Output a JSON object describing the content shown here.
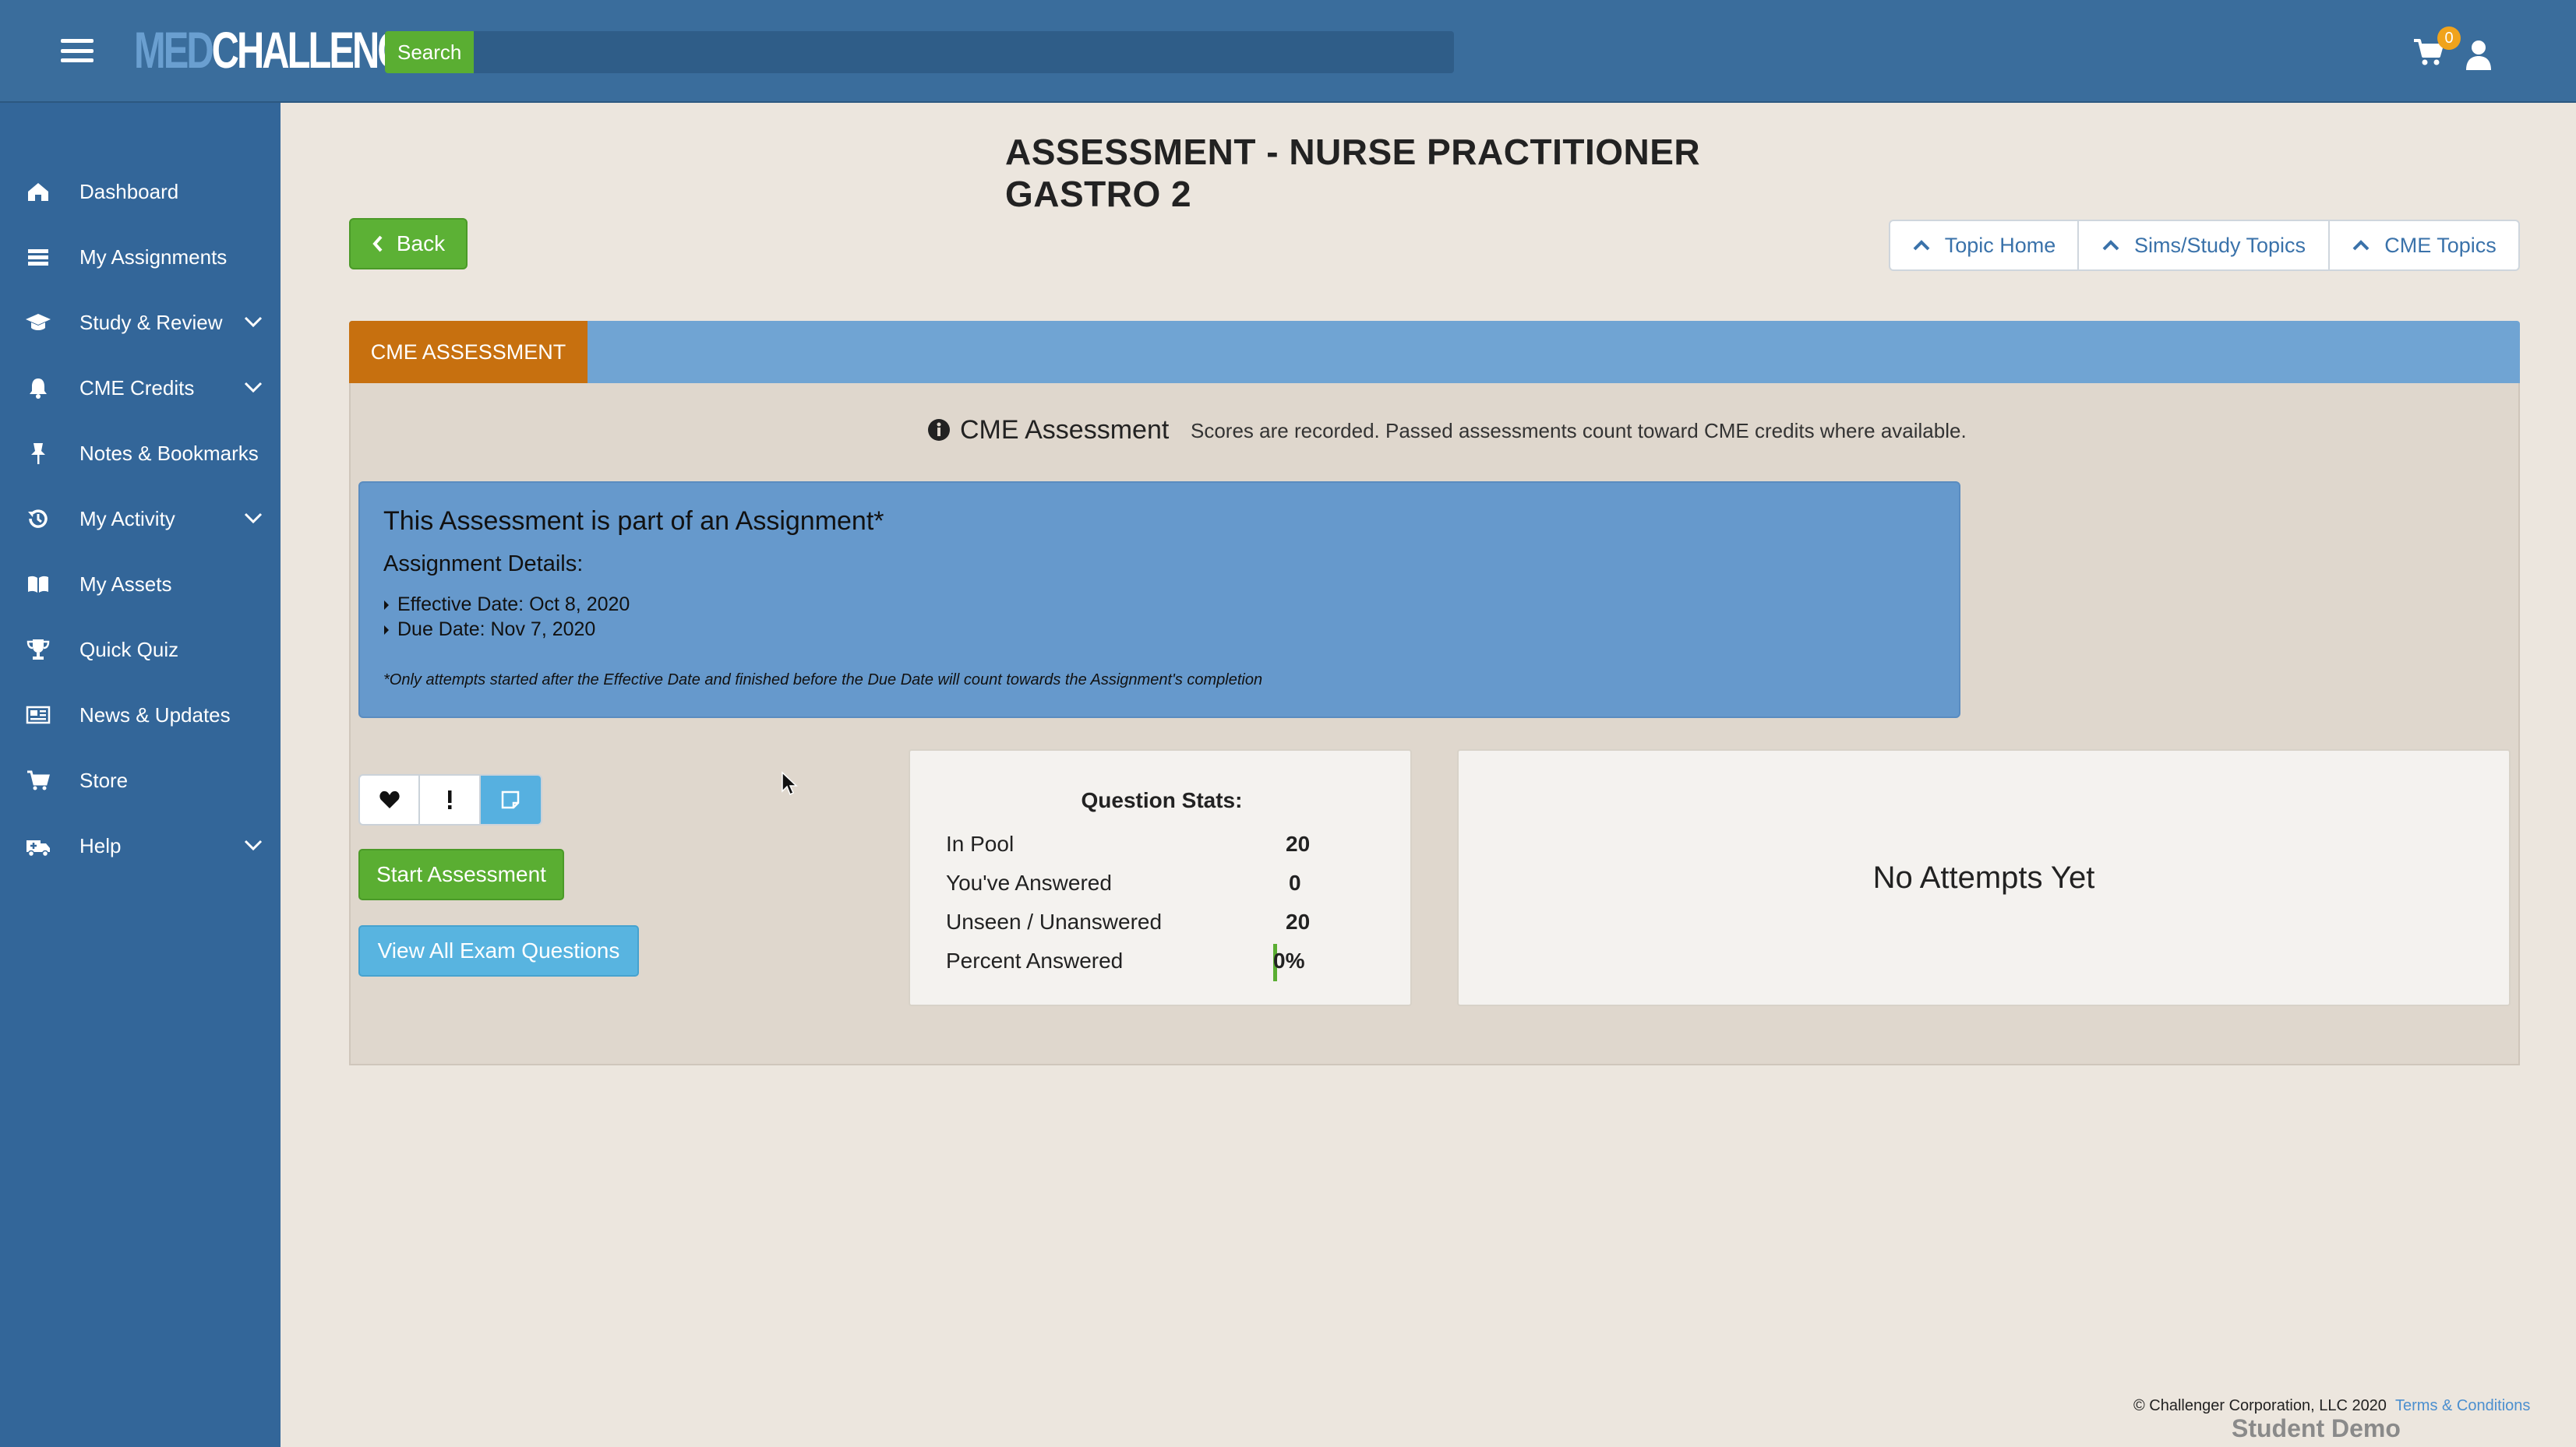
{
  "header": {
    "logo_med": "MED",
    "logo_challenger": "CHALLENGER",
    "search_label": "Search",
    "search_placeholder": "",
    "cart_count": "0"
  },
  "sidebar": {
    "items": [
      {
        "label": "Dashboard",
        "icon": "home-icon",
        "expandable": false
      },
      {
        "label": "My Assignments",
        "icon": "list-icon",
        "expandable": false
      },
      {
        "label": "Study & Review",
        "icon": "graduation-cap-icon",
        "expandable": true
      },
      {
        "label": "CME Credits",
        "icon": "bell-icon",
        "expandable": true
      },
      {
        "label": "Notes & Bookmarks",
        "icon": "pin-icon",
        "expandable": false
      },
      {
        "label": "My Activity",
        "icon": "history-icon",
        "expandable": true
      },
      {
        "label": "My Assets",
        "icon": "book-icon",
        "expandable": false
      },
      {
        "label": "Quick Quiz",
        "icon": "trophy-icon",
        "expandable": false
      },
      {
        "label": "News & Updates",
        "icon": "newspaper-icon",
        "expandable": false
      },
      {
        "label": "Store",
        "icon": "cart-icon",
        "expandable": false
      },
      {
        "label": "Help",
        "icon": "ambulance-icon",
        "expandable": true
      }
    ]
  },
  "main": {
    "title": "ASSESSMENT - NURSE PRACTITIONER GASTRO 2",
    "back_label": "Back",
    "topic_buttons": [
      "Topic Home",
      "Sims/Study Topics",
      "CME Topics"
    ],
    "tab_label": "CME ASSESSMENT",
    "cme_heading": "CME Assessment",
    "cme_note": "Scores are recorded. Passed assessments count toward CME credits where available.",
    "assignment": {
      "title": "This Assessment is part of an Assignment*",
      "details_label": "Assignment Details:",
      "effective": "Effective Date: Oct 8, 2020",
      "due": "Due Date: Nov 7, 2020",
      "footnote": "*Only attempts started after the Effective Date and finished before the Due Date will count towards the Assignment's completion"
    },
    "start_label": "Start Assessment",
    "view_label": "View All Exam Questions",
    "stats": {
      "title": "Question Stats:",
      "rows": [
        {
          "label": "In Pool",
          "value": "20"
        },
        {
          "label": "You've Answered",
          "value": "0"
        },
        {
          "label": "Unseen / Unanswered",
          "value": "20"
        },
        {
          "label": "Percent Answered",
          "value": "0%"
        }
      ],
      "percent_answered": 0
    },
    "attempts_text": "No Attempts Yet"
  },
  "footer": {
    "copyright": "© Challenger Corporation, LLC 2020",
    "terms": "Terms & Conditions",
    "student": "Student Demo (student_demo)"
  },
  "colors": {
    "topbar": "#3a6d9c",
    "sidebar": "#336699",
    "accent_green": "#5aae32",
    "tab_orange": "#c7700f",
    "tab_bar_blue": "#70a4d3",
    "assignment_blue": "#6699cc",
    "info_blue": "#58b4e0"
  }
}
